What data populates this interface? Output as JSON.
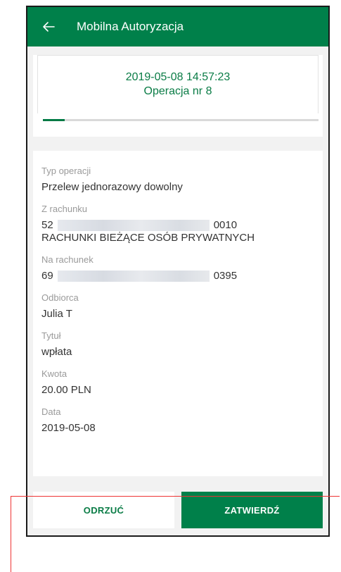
{
  "header": {
    "title": "Mobilna Autoryzacja",
    "back_icon": "arrow-left-icon"
  },
  "summary": {
    "datetime": "2019-05-08 14:57:23",
    "operation": "Operacja nr 8",
    "progress": 0.08
  },
  "details": {
    "operation_type": {
      "label": "Typ operacji",
      "value": "Przelew jednorazowy dowolny"
    },
    "from_account": {
      "label": "Z rachunku",
      "prefix": "52",
      "suffix": "0010",
      "name": "RACHUNKI BIEŻĄCE OSÓB PRYWATNYCH"
    },
    "to_account": {
      "label": "Na rachunek",
      "prefix": "69",
      "suffix": "0395"
    },
    "recipient": {
      "label": "Odbiorca",
      "value": "Julia T"
    },
    "title": {
      "label": "Tytuł",
      "value": "wpłata"
    },
    "amount": {
      "label": "Kwota",
      "value": "20.00 PLN"
    },
    "date": {
      "label": "Data",
      "value": "2019-05-08"
    }
  },
  "actions": {
    "reject_label": "ODRZUĆ",
    "accept_label": "ZATWIERDŹ"
  },
  "colors": {
    "primary": "#00804a",
    "highlight": "#e33333"
  }
}
